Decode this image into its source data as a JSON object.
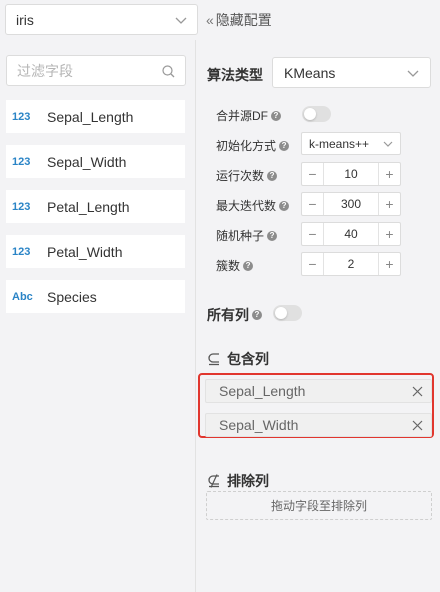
{
  "dataset": {
    "selected": "iris"
  },
  "hide_config": {
    "label": "隐藏配置",
    "icon": "double-chevron-left-icon"
  },
  "field_filter": {
    "placeholder": "过滤字段"
  },
  "fields": [
    {
      "type": "123",
      "name": "Sepal_Length"
    },
    {
      "type": "123",
      "name": "Sepal_Width"
    },
    {
      "type": "123",
      "name": "Petal_Length"
    },
    {
      "type": "123",
      "name": "Petal_Width"
    },
    {
      "type": "Abc",
      "name": "Species"
    }
  ],
  "algorithm": {
    "label": "算法类型",
    "selected": "KMeans"
  },
  "params": {
    "merge_source": {
      "label": "合并源DF",
      "enabled": false
    },
    "init_method": {
      "label": "初始化方式",
      "selected": "k-means++"
    },
    "n_init": {
      "label": "运行次数",
      "value": "10"
    },
    "max_iter": {
      "label": "最大迭代数",
      "value": "300"
    },
    "random_seed": {
      "label": "随机种子",
      "value": "40"
    },
    "n_clusters": {
      "label": "簇数",
      "value": "2"
    }
  },
  "all_columns": {
    "label": "所有列",
    "enabled": false
  },
  "include": {
    "label": "包含列",
    "icon": "subset-icon",
    "columns": [
      "Sepal_Length",
      "Sepal_Width"
    ]
  },
  "exclude": {
    "label": "排除列",
    "icon": "not-subset-icon",
    "placeholder": "拖动字段至排除列"
  },
  "colors": {
    "accent_blue": "#2a84c6",
    "highlight_red": "#e1362e"
  }
}
